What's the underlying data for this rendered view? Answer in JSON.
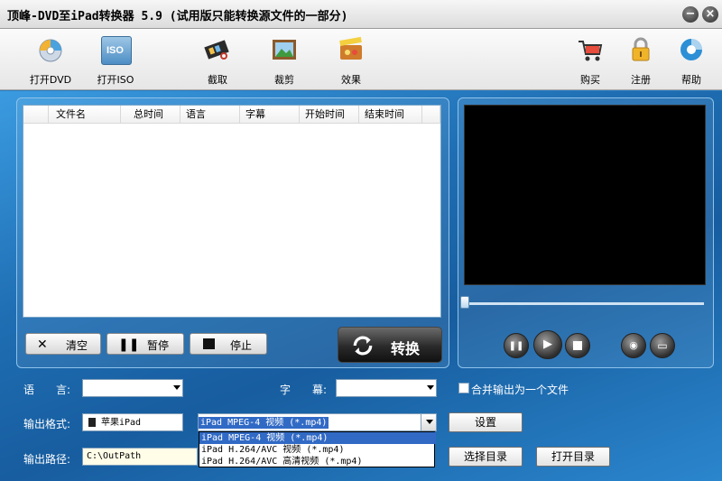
{
  "window": {
    "title": "顶峰-DVD至iPad转换器 5.9 (试用版只能转换源文件的一部分)"
  },
  "toolbar": {
    "open_dvd": "打开DVD",
    "open_iso": "打开ISO",
    "iso_badge": "ISO",
    "capture": "截取",
    "crop": "裁剪",
    "effect": "效果",
    "buy": "购买",
    "register": "注册",
    "help": "帮助"
  },
  "file_list": {
    "columns": [
      "文件名",
      "总时间",
      "语言",
      "字幕",
      "开始时间",
      "结束时间"
    ]
  },
  "actions": {
    "clear": "清空",
    "pause": "暂停",
    "stop": "停止",
    "convert": "转换"
  },
  "options": {
    "audio_label": "语　　言:",
    "subtitle_label": "字　　幕:",
    "merge_label": "合并输出为一个文件",
    "format_label": "输出格式:",
    "device_value": "苹果iPad",
    "format_value": "iPad MPEG-4 视频 (*.mp4)",
    "settings": "设置",
    "path_label": "输出路径:",
    "path_value": "C:\\OutPath",
    "choose_dir": "选择目录",
    "open_dir": "打开目录"
  },
  "format_options": [
    "iPad MPEG-4 视频 (*.mp4)",
    "iPad H.264/AVC 视频 (*.mp4)",
    "iPad H.264/AVC 高清视频 (*.mp4)"
  ],
  "colors": {
    "accent": "#316ac5",
    "background": "#1f6eb3"
  }
}
